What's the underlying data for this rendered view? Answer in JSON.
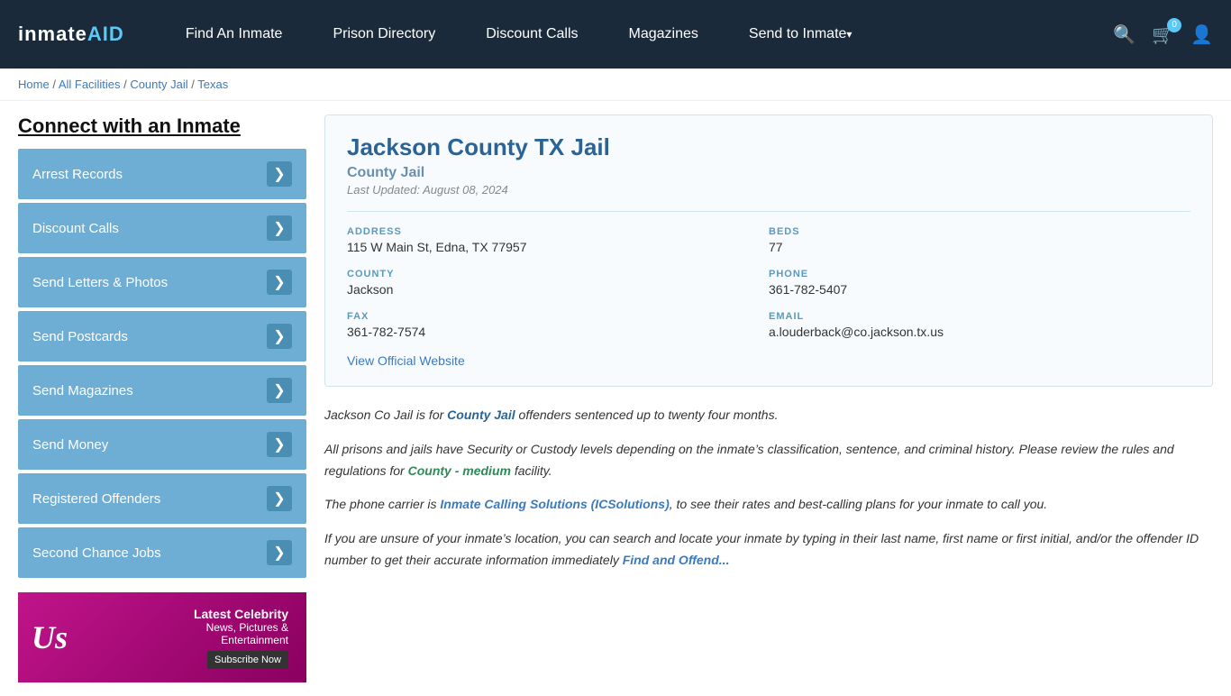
{
  "navbar": {
    "logo": "inmateAID",
    "links": [
      {
        "label": "Find An Inmate",
        "id": "find-inmate",
        "dropdown": false
      },
      {
        "label": "Prison Directory",
        "id": "prison-directory",
        "dropdown": false
      },
      {
        "label": "Discount Calls",
        "id": "discount-calls",
        "dropdown": false
      },
      {
        "label": "Magazines",
        "id": "magazines",
        "dropdown": false
      },
      {
        "label": "Send to Inmate",
        "id": "send-to-inmate",
        "dropdown": true
      }
    ],
    "cart_count": "0"
  },
  "breadcrumb": {
    "items": [
      {
        "label": "Home",
        "link": true
      },
      {
        "label": "All Facilities",
        "link": true
      },
      {
        "label": "County Jail",
        "link": true
      },
      {
        "label": "Texas",
        "link": true
      }
    ]
  },
  "sidebar": {
    "title": "Connect with an Inmate",
    "menu_items": [
      {
        "label": "Arrest Records",
        "id": "arrest-records"
      },
      {
        "label": "Discount Calls",
        "id": "discount-calls"
      },
      {
        "label": "Send Letters & Photos",
        "id": "send-letters"
      },
      {
        "label": "Send Postcards",
        "id": "send-postcards"
      },
      {
        "label": "Send Magazines",
        "id": "send-magazines"
      },
      {
        "label": "Send Money",
        "id": "send-money"
      },
      {
        "label": "Registered Offenders",
        "id": "registered-offenders"
      },
      {
        "label": "Second Chance Jobs",
        "id": "second-chance-jobs"
      }
    ],
    "ad": {
      "us_logo": "Us",
      "title": "Latest Celebrity",
      "subtitle": "News, Pictures &",
      "sub2": "Entertainment",
      "button": "Subscribe Now"
    }
  },
  "facility": {
    "name": "Jackson County TX Jail",
    "type": "County Jail",
    "last_updated": "Last Updated: August 08, 2024",
    "address_label": "ADDRESS",
    "address_value": "115 W Main St, Edna, TX 77957",
    "beds_label": "BEDS",
    "beds_value": "77",
    "county_label": "COUNTY",
    "county_value": "Jackson",
    "phone_label": "PHONE",
    "phone_value": "361-782-5407",
    "fax_label": "FAX",
    "fax_value": "361-782-7574",
    "email_label": "EMAIL",
    "email_value": "a.louderback@co.jackson.tx.us",
    "website_label": "View Official Website"
  },
  "description": {
    "para1_pre": "Jackson Co Jail is for ",
    "para1_highlight": "County Jail",
    "para1_post": " offenders sentenced up to twenty four months.",
    "para2_pre": "All prisons and jails have Security or Custody levels depending on the inmate’s classification, sentence, and criminal history. Please review the rules and regulations for ",
    "para2_highlight": "County - medium",
    "para2_post": " facility.",
    "para3_pre": "The phone carrier is ",
    "para3_highlight": "Inmate Calling Solutions (ICSolutions)",
    "para3_post": ", to see their rates and best-calling plans for your inmate to call you.",
    "para4": "If you are unsure of your inmate’s location, you can search and locate your inmate by typing in their last name, first name or first initial, and/or the offender ID number to get their accurate information immediately",
    "para4_link": "Find and Offend..."
  }
}
